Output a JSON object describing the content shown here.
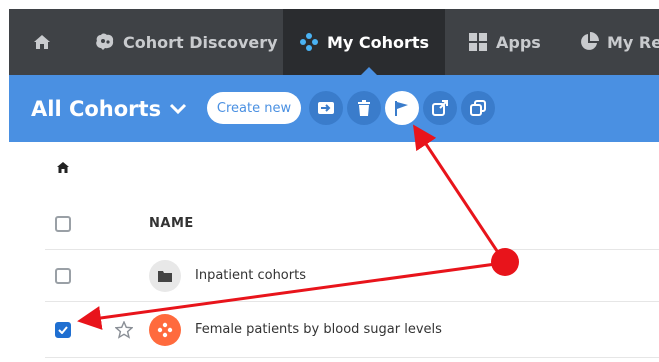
{
  "topnav": {
    "items": [
      {
        "label": "",
        "icon": "home-icon"
      },
      {
        "label": "Cohort Discovery",
        "icon": "brain-icon"
      },
      {
        "label": "My Cohorts",
        "icon": "cohorts-icon",
        "active": true
      },
      {
        "label": "Apps",
        "icon": "grid-icon"
      },
      {
        "label": "My Re",
        "icon": "pie-chart-icon"
      }
    ]
  },
  "toolbar": {
    "title": "All Cohorts",
    "create_label": "Create new",
    "actions": [
      "move-icon",
      "trash-icon",
      "flag-icon",
      "share-icon",
      "copy-icon"
    ]
  },
  "table": {
    "header": {
      "name": "NAME"
    },
    "rows": [
      {
        "label": "Inpatient cohorts",
        "type": "folder",
        "checked": false
      },
      {
        "label": "Female patients by blood sugar levels",
        "type": "cohort",
        "checked": true
      }
    ]
  },
  "colors": {
    "nav_bg": "#3f4246",
    "nav_active": "#2a2c2f",
    "toolbar_bg": "#4a90e2",
    "annotation": "#e8141b"
  }
}
